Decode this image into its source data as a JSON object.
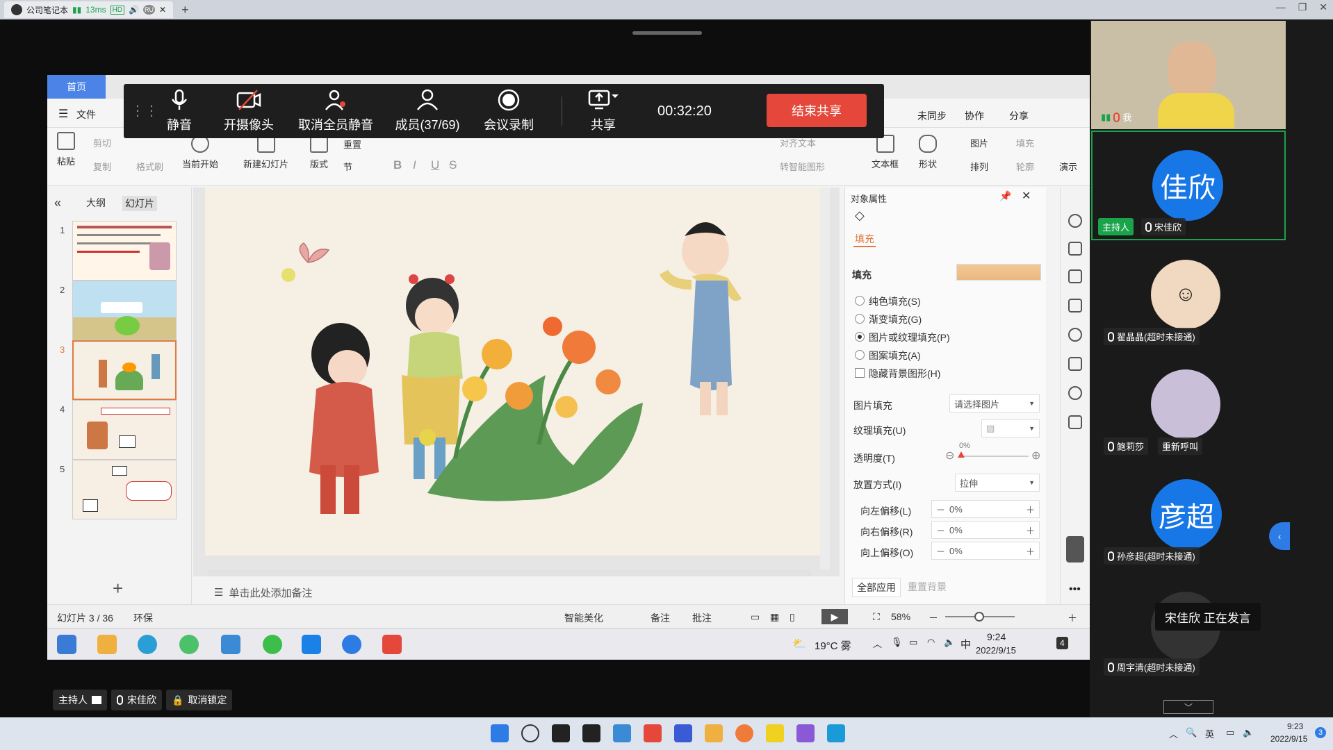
{
  "browser_tab": {
    "title": "公司笔记本",
    "ping": "13ms",
    "hd": "HD",
    "ru": "RU"
  },
  "wps": {
    "home_tab": "首页",
    "menu_file": "文件",
    "menu_right": [
      "未同步",
      "协作",
      "分享"
    ],
    "ribbon": {
      "paste": "粘贴",
      "cut": "剪切",
      "copy": "复制",
      "format_painter": "格式刷",
      "from_current": "当前开始",
      "new_slide": "新建幻灯片",
      "layout": "版式",
      "reset": "重置",
      "section": "节",
      "bold": "B",
      "italic": "I",
      "underline": "U",
      "strike": "S",
      "text_box": "文本框",
      "shapes": "形状",
      "picture": "图片",
      "fill": "填充",
      "arrange": "排列",
      "outline": "轮廓",
      "align_text": "对齐文本",
      "smart_shape": "转智能图形",
      "present": "演示"
    }
  },
  "meeting_bar": {
    "mute": "静音",
    "camera": "开摄像头",
    "unmute_all": "取消全员静音",
    "members": "成员(37/69)",
    "record": "会议录制",
    "share": "共享",
    "timer": "00:32:20",
    "end_share": "结束共享"
  },
  "slide_panel": {
    "outline_tab": "大纲",
    "slides_tab": "幻灯片",
    "thumbs": [
      {
        "num": "1"
      },
      {
        "num": "2"
      },
      {
        "num": "3"
      },
      {
        "num": "4"
      },
      {
        "num": "5"
      }
    ],
    "add": "+"
  },
  "notes_placeholder": "单击此处添加备注",
  "properties": {
    "header": "对象属性",
    "tab_fill": "填充",
    "section_fill": "填充",
    "options": [
      "纯色填充(S)",
      "渐变填充(G)",
      "图片或纹理填充(P)",
      "图案填充(A)"
    ],
    "selected_option": "图片或纹理填充(P)",
    "hide_bg": "隐藏背景图形(H)",
    "picture_fill_label": "图片填充",
    "picture_fill_value": "请选择图片",
    "texture_fill_label": "纹理填充(U)",
    "transparency_label": "透明度(T)",
    "transparency_value": "0%",
    "placement_label": "放置方式(I)",
    "placement_value": "拉伸",
    "offset_left_label": "向左偏移(L)",
    "offset_left_value": "0%",
    "offset_right_label": "向右偏移(R)",
    "offset_right_value": "0%",
    "offset_up_label": "向上偏移(O)",
    "offset_up_value": "0%",
    "apply_all": "全部应用",
    "reset_bg": "重置背景"
  },
  "status_bar": {
    "slide_count": "幻灯片 3 / 36",
    "theme": "环保",
    "beautify": "智能美化",
    "notes": "备注",
    "comments": "批注",
    "zoom": "58%"
  },
  "inner_taskbar": {
    "weather": "19°C 雾",
    "ime": "中",
    "time": "9:24",
    "date": "2022/9/15",
    "notif": "4"
  },
  "participants": [
    {
      "name": "我",
      "role": ""
    },
    {
      "name": "宋佳欣",
      "avatar_text": "佳欣",
      "role": "主持人"
    },
    {
      "name": "翟晶晶(超时未接通)"
    },
    {
      "name": "鲍莉莎",
      "action": "重新呼叫"
    },
    {
      "name": "孙彦超(超时未接通)",
      "avatar_text": "彦超"
    },
    {
      "name": "周宇清(超时未接通)"
    }
  ],
  "speaking_toast": "宋佳欣  正在发言",
  "host_bar": {
    "role": "主持人",
    "name": "宋佳欣",
    "unlock": "取消锁定"
  },
  "outer_taskbar": {
    "ime": "英",
    "time": "9:23",
    "date": "2022/9/15",
    "notif": "3"
  },
  "colors": {
    "accent_blue": "#4b83e6",
    "end_red": "#e5483a",
    "host_green": "#1aa34a",
    "avatar_blue": "#1877e6",
    "selection_orange": "#e07a3e"
  }
}
